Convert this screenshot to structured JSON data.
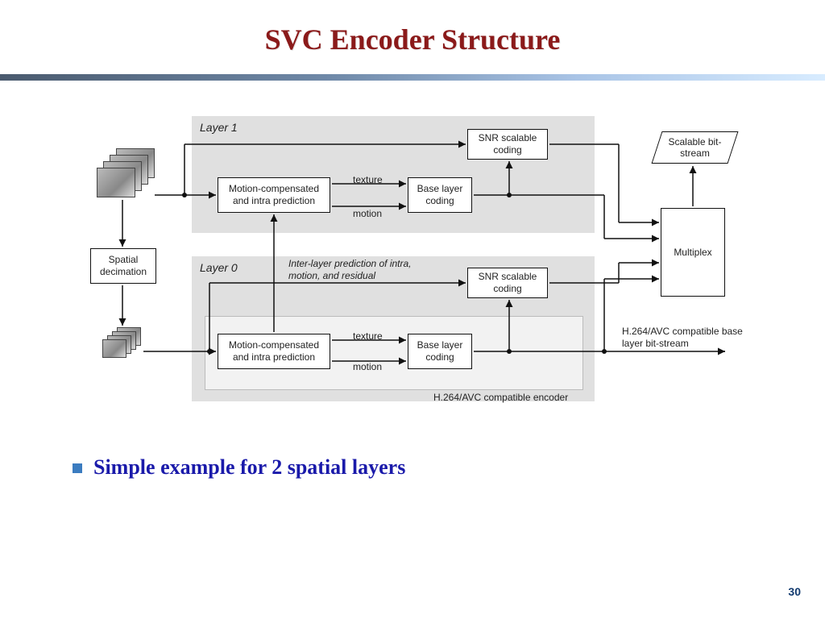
{
  "title": "SVC Encoder Structure",
  "page_number": "30",
  "bullet": "Simple example for 2 spatial layers",
  "diagram": {
    "layer1": {
      "title": "Layer 1",
      "mc_pred": "Motion-compensated and intra prediction",
      "texture": "texture",
      "motion": "motion",
      "base_coding": "Base layer coding",
      "snr": "SNR scalable coding"
    },
    "layer0": {
      "title": "Layer 0",
      "mc_pred": "Motion-compensated and intra prediction",
      "texture": "texture",
      "motion": "motion",
      "base_coding": "Base layer coding",
      "snr": "SNR scalable coding",
      "interlayer_note": "Inter-layer prediction of intra, motion, and residual",
      "encoder_caption": "H.264/AVC compatible encoder"
    },
    "side": {
      "spatial_decimation": "Spatial decimation",
      "multiplex": "Multiplex",
      "scalable_bitstream": "Scalable bit-stream",
      "base_bitstream": "H.264/AVC compatible base layer bit-stream"
    }
  }
}
